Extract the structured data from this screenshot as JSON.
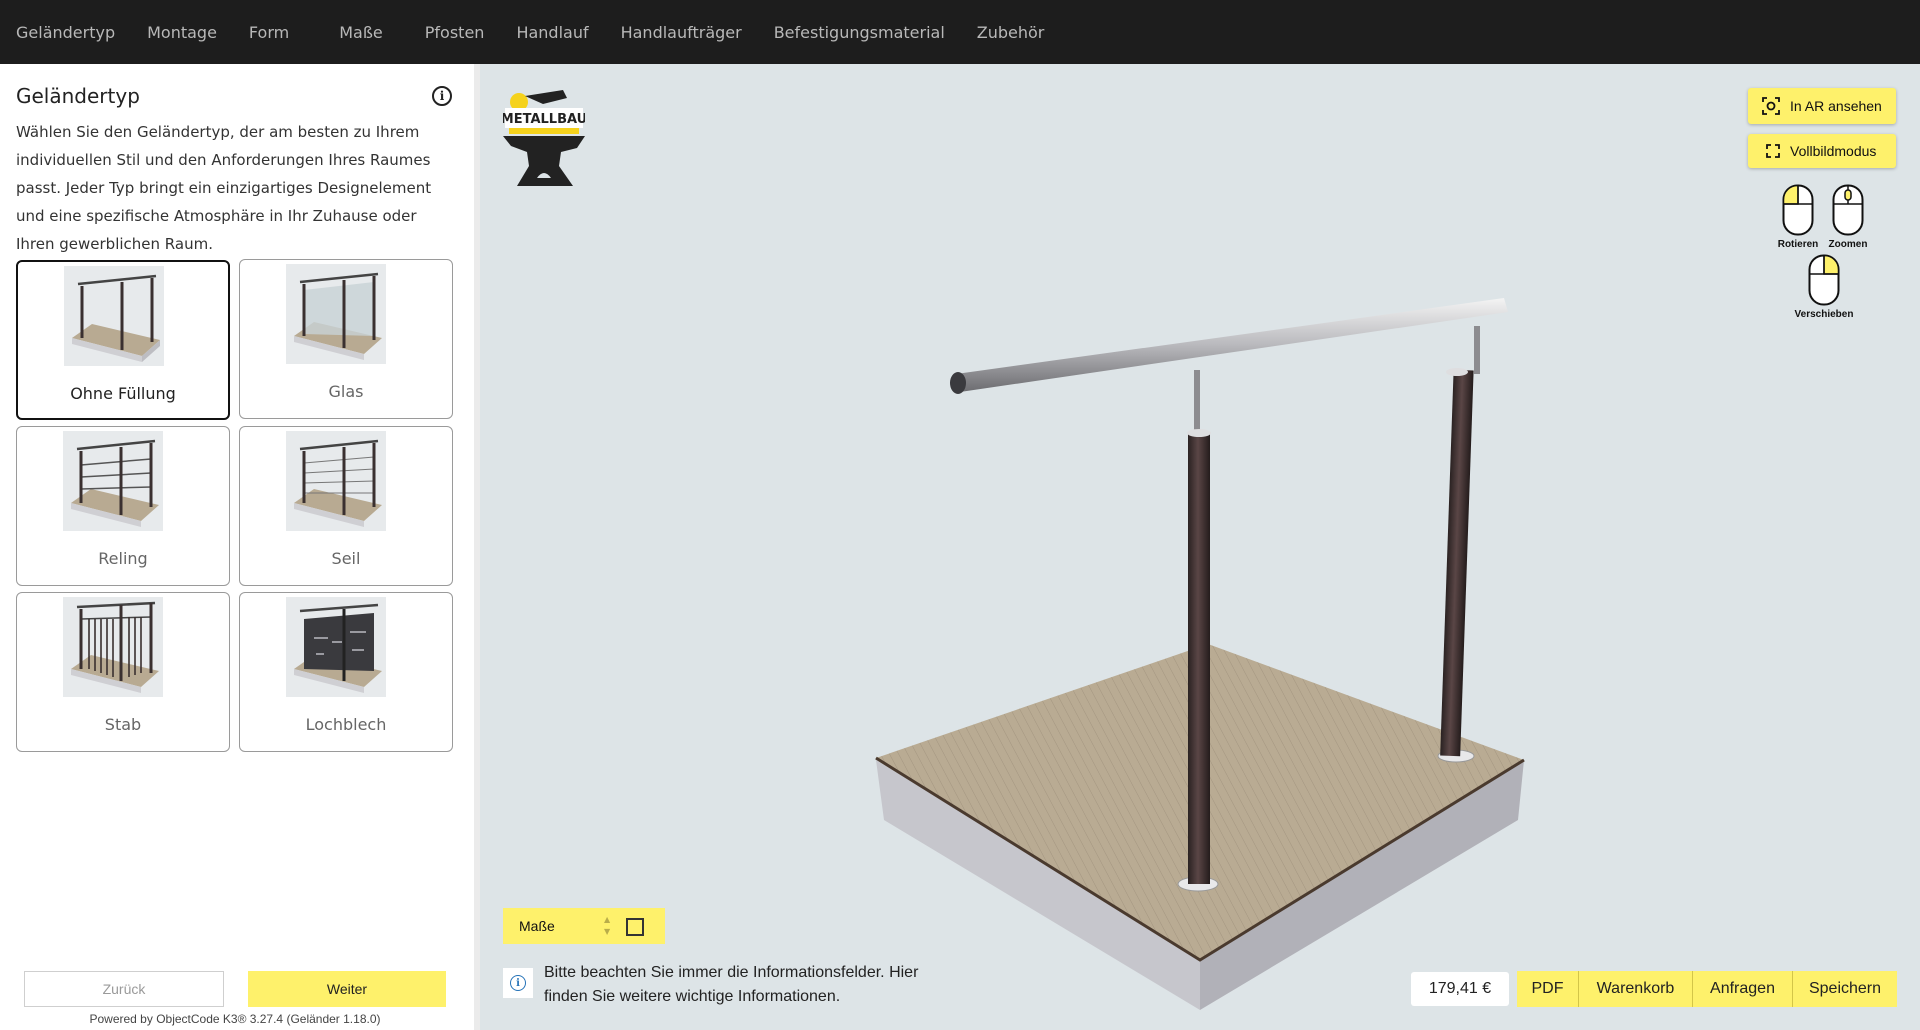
{
  "nav": {
    "items": [
      "Geländertyp",
      "Montage",
      "Form",
      "Maße",
      "Pfosten",
      "Handlauf",
      "Handlaufträger",
      "Befestigungsmaterial",
      "Zubehör"
    ],
    "active_index": 0
  },
  "sidebar": {
    "title": "Geländertyp",
    "description": "Wählen Sie den Geländertyp, der am besten zu Ihrem individuellen Stil und den Anforderungen Ihres Raumes passt. Jeder Typ bringt ein einzigartiges Designelement und eine spezifische Atmosphäre in Ihr Zuhause oder Ihren gewerblichen Raum.",
    "options": [
      {
        "label": "Ohne Füllung",
        "selected": true
      },
      {
        "label": "Glas",
        "selected": false
      },
      {
        "label": "Reling",
        "selected": false
      },
      {
        "label": "Seil",
        "selected": false
      },
      {
        "label": "Stab",
        "selected": false
      },
      {
        "label": "Lochblech",
        "selected": false
      }
    ],
    "back_label": "Zurück",
    "next_label": "Weiter",
    "powered_by": "Powered by ObjectCode K3® 3.27.4 (Geländer 1.18.0)"
  },
  "viewport": {
    "logo_text": "METALLBAU",
    "ar_label": "In AR ansehen",
    "fullscreen_label": "Vollbildmodus",
    "mouse_rotate": "Rotieren",
    "mouse_zoom": "Zoomen",
    "mouse_pan": "Verschieben",
    "masse_label": "Maße",
    "hint": "Bitte beachten Sie immer die Informationsfelder. Hier finden Sie weitere wichtige Informationen.",
    "price": "179,41 €",
    "actions": [
      "PDF",
      "Warenkorb",
      "Anfragen",
      "Speichern"
    ]
  },
  "colors": {
    "accent": "#fef16b",
    "nav_bg": "#1d1d1d",
    "post": "#3a2f2f",
    "deck": "#b7aa94"
  }
}
